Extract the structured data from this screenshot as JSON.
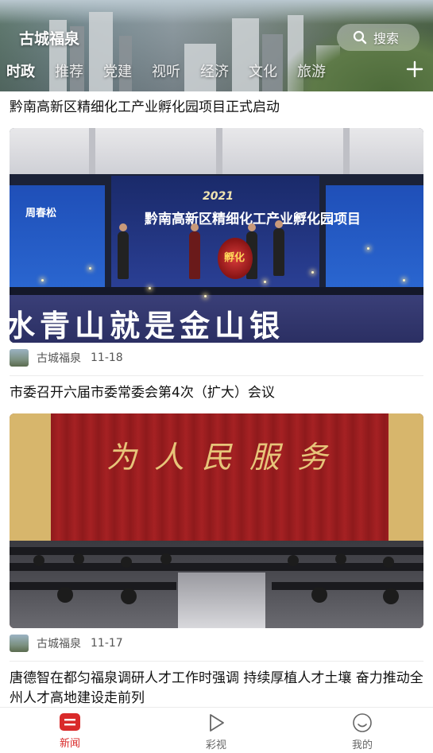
{
  "header": {
    "title": "古城福泉",
    "search_label": "搜索",
    "tabs": [
      "时政",
      "推荐",
      "党建",
      "视听",
      "经济",
      "文化",
      "旅游"
    ],
    "active_tab": "时政",
    "add_icon": "plus-icon"
  },
  "articles": [
    {
      "title": "黔南高新区精细化工产业孵化园项目正式启动",
      "image_text": {
        "year": "2021",
        "screen_title": "黔南高新区精细化工产业孵化园项目",
        "speaker_name": "周春松",
        "orb_label": "孵化",
        "slogan": "水青山就是金山银"
      },
      "source": "古城福泉",
      "date": "11-18"
    },
    {
      "title": "市委召开六届市委常委会第4次（扩大）会议",
      "image_text": {
        "calligraphy": "为人民服务"
      },
      "source": "古城福泉",
      "date": "11-17"
    },
    {
      "title": "唐德智在都匀福泉调研人才工作时强调 持续厚植人才土壤 奋力推动全州人才高地建设走前列"
    }
  ],
  "tabbar": {
    "items": [
      {
        "label": "新闻",
        "icon": "news-icon",
        "active": true
      },
      {
        "label": "彩视",
        "icon": "play-icon",
        "active": false
      },
      {
        "label": "我的",
        "icon": "smile-icon",
        "active": false
      }
    ],
    "accent_color": "#d92a2a"
  }
}
